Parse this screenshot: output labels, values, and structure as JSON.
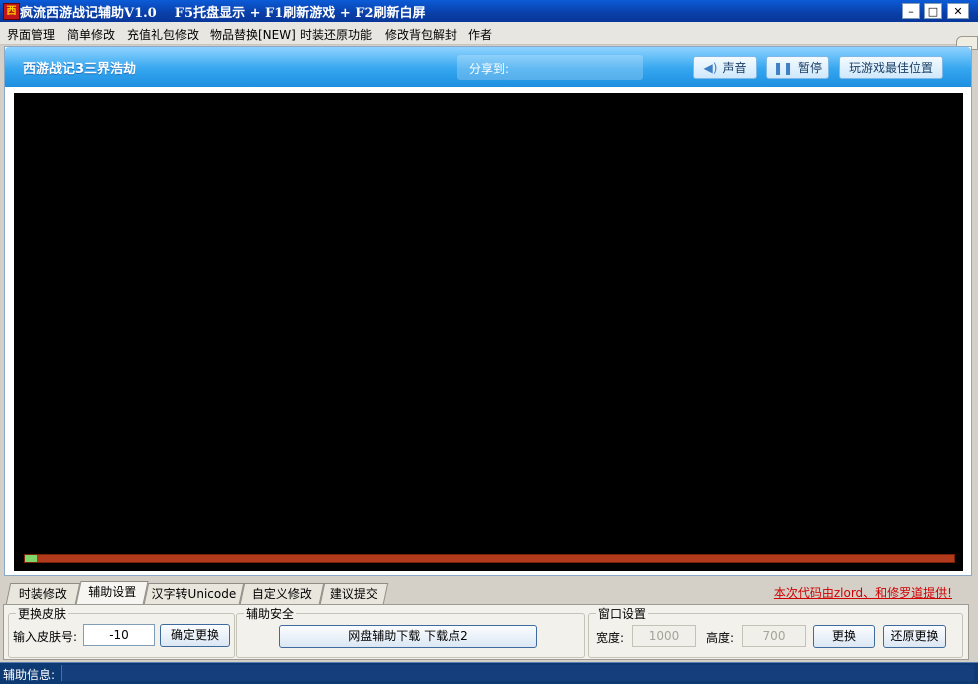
{
  "window": {
    "icon_char": "西",
    "title": "疯流西游战记辅助V1.0    F5托盘显示 + F1刷新游戏 + F2刷新白屏",
    "minimize": "–",
    "maximize": "□",
    "close": "✕"
  },
  "menu": {
    "items": [
      "界面管理",
      "简单修改",
      "充值礼包修改",
      "物品替换[NEW]",
      "时装还原功能",
      "修改背包解封",
      "作者"
    ]
  },
  "game": {
    "title": "西游战记3三界浩劫",
    "share_label": "分享到:",
    "sound_label": "声音",
    "pause_label": "暂停",
    "best_position_label": "玩游戏最佳位置",
    "load_progress": 0.013
  },
  "tabs": {
    "items": [
      "时装修改",
      "辅助设置",
      "汉字转Unicode",
      "自定义修改",
      "建议提交"
    ],
    "active_index": 1,
    "credit": "本次代码由zlord、和修罗道提供!"
  },
  "panel": {
    "skin_group": {
      "title": "更换皮肤",
      "label": "输入皮肤号:",
      "value": "-10",
      "confirm": "确定更换"
    },
    "security_group": {
      "title": "辅助安全",
      "download": "网盘辅助下载 下载点2"
    },
    "window_group": {
      "title": "窗口设置",
      "width_label": "宽度:",
      "width_value": "1000",
      "height_label": "高度:",
      "height_value": "700",
      "change": "更换",
      "restore": "还原更换"
    }
  },
  "status": {
    "label": "辅助信息:",
    "value": ""
  },
  "colors": {
    "title_bar": "#0a3fa8",
    "game_header": "#35a6ef",
    "progress_track": "#b23a1c",
    "progress_fill": "#7fd66a",
    "credit_text": "#d00000",
    "status_bar": "#0e3a73"
  }
}
